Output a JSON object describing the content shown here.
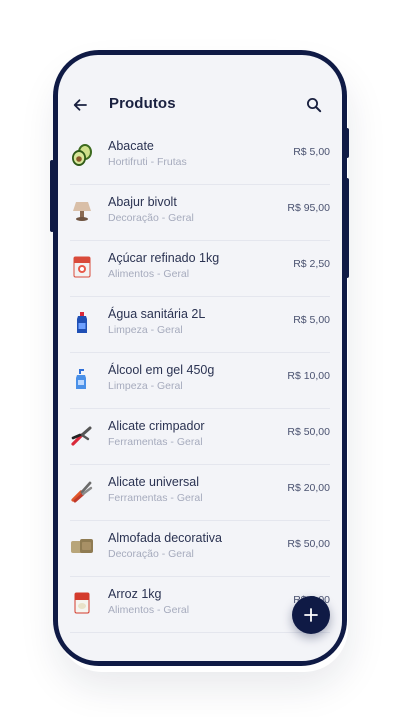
{
  "header": {
    "title": "Produtos",
    "back_icon": "arrow-left-icon",
    "search_icon": "search-icon"
  },
  "products": [
    {
      "name": "Abacate",
      "category": "Hortifruti - Frutas",
      "price": "R$ 5,00",
      "icon": "avocado-icon"
    },
    {
      "name": "Abajur bivolt",
      "category": "Decoração - Geral",
      "price": "R$ 95,00",
      "icon": "lamp-icon"
    },
    {
      "name": "Açúcar refinado 1kg",
      "category": "Alimentos - Geral",
      "price": "R$ 2,50",
      "icon": "sugar-bag-icon"
    },
    {
      "name": "Água sanitária 2L",
      "category": "Limpeza - Geral",
      "price": "R$ 5,00",
      "icon": "bleach-bottle-icon"
    },
    {
      "name": "Álcool em gel 450g",
      "category": "Limpeza - Geral",
      "price": "R$ 10,00",
      "icon": "gel-bottle-icon"
    },
    {
      "name": "Alicate crimpador",
      "category": "Ferramentas - Geral",
      "price": "R$ 50,00",
      "icon": "crimper-icon"
    },
    {
      "name": "Alicate universal",
      "category": "Ferramentas - Geral",
      "price": "R$ 20,00",
      "icon": "pliers-icon"
    },
    {
      "name": "Almofada decorativa",
      "category": "Decoração - Geral",
      "price": "R$ 50,00",
      "icon": "cushion-icon"
    },
    {
      "name": "Arroz 1kg",
      "category": "Alimentos - Geral",
      "price": "R$ 5,00",
      "icon": "rice-bag-icon"
    }
  ],
  "fab": {
    "icon": "plus-icon"
  },
  "colors": {
    "primary": "#0f1a45",
    "background": "#f3f4f8",
    "text": "#2b3352",
    "muted": "#a6abbd"
  }
}
